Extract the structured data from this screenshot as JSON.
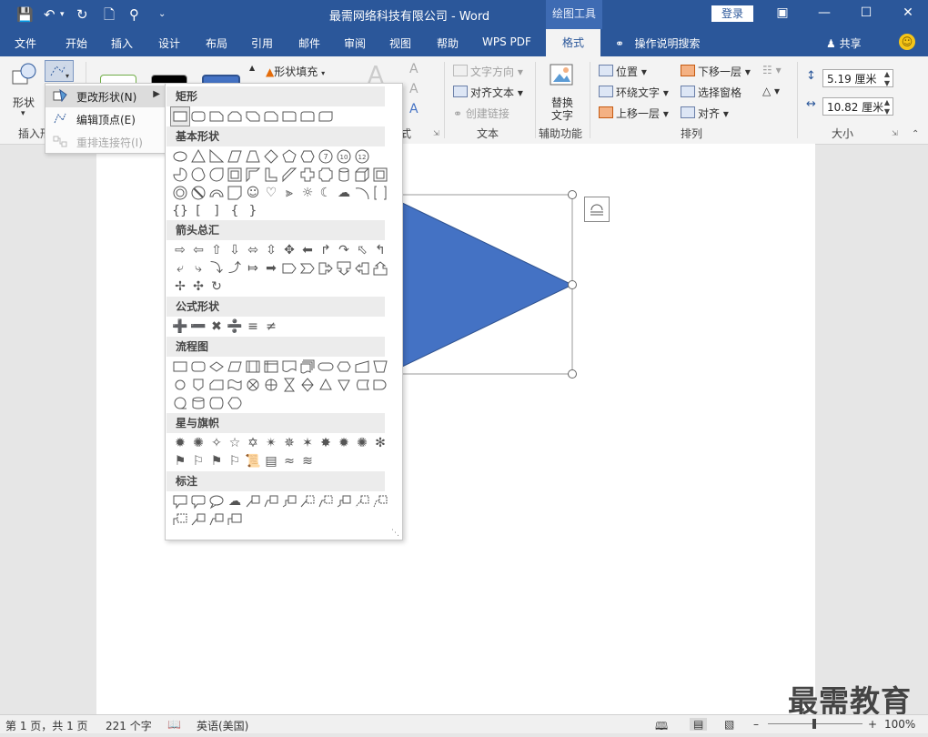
{
  "window": {
    "title": "最需网络科技有限公司  -  Word",
    "context_group": "绘图工具",
    "login_label": "登录",
    "quick_access": [
      "save-icon",
      "undo-icon",
      "redo-icon",
      "new-doc-icon",
      "touch-mode-icon",
      "customize-icon"
    ],
    "controls": [
      "ribbon-display-icon",
      "minimize-icon",
      "maximize-icon",
      "close-icon"
    ]
  },
  "tabs": [
    {
      "label": "文件"
    },
    {
      "label": "开始"
    },
    {
      "label": "插入"
    },
    {
      "label": "设计"
    },
    {
      "label": "布局"
    },
    {
      "label": "引用"
    },
    {
      "label": "邮件"
    },
    {
      "label": "审阅"
    },
    {
      "label": "视图"
    },
    {
      "label": "帮助"
    },
    {
      "label": "WPS PDF"
    },
    {
      "label": "格式",
      "active": true
    }
  ],
  "tell_me": "操作说明搜索",
  "share": "共享",
  "ribbon": {
    "insert_shapes": {
      "shapes_label": "形状",
      "group_label": "插入形"
    },
    "shape_styles": {
      "fill_label": "形状填充",
      "group_label": "式"
    },
    "wordart": {
      "letters": [
        "A",
        "A",
        "A",
        "A"
      ]
    },
    "text": {
      "direction_label": "文字方向",
      "align_label": "对齐文本",
      "link_label": "创建链接",
      "group_label": "文本"
    },
    "accessibility": {
      "alt_text_line1": "替换",
      "alt_text_line2": "文字",
      "group_label": "辅助功能"
    },
    "arrange": {
      "position_label": "位置",
      "wrap_label": "环绕文字",
      "bring_forward_label": "上移一层",
      "send_backward_label": "下移一层",
      "selection_pane_label": "选择窗格",
      "align_label": "对齐",
      "group_label": "排列"
    },
    "size": {
      "height_value": "5.19 厘米",
      "width_value": "10.82 厘米",
      "group_label": "大小"
    }
  },
  "edit_shape_menu": {
    "items": [
      {
        "label": "更改形状(N)",
        "enabled": true,
        "has_submenu": true
      },
      {
        "label": "编辑顶点(E)",
        "enabled": true
      },
      {
        "label": "重排连接符(I)",
        "enabled": false
      }
    ]
  },
  "shape_gallery": {
    "categories": [
      {
        "label": "矩形",
        "count": 9
      },
      {
        "label": "基本形状",
        "count": 42
      },
      {
        "label": "箭头总汇",
        "count": 27
      },
      {
        "label": "公式形状",
        "count": 6
      },
      {
        "label": "流程图",
        "count": 28
      },
      {
        "label": "星与旗帜",
        "count": 20
      },
      {
        "label": "标注",
        "count": 16
      }
    ],
    "basic_shape_numbers": [
      "7",
      "10",
      "12"
    ],
    "brace_glyphs": [
      "{}",
      "[",
      "]",
      "{",
      "}"
    ]
  },
  "shape": {
    "fill_color": "#4472c4",
    "kind": "triangle"
  },
  "status_bar": {
    "page": "第 1 页，共 1 页",
    "words": "221 个字",
    "language": "英语(美国)",
    "zoom": "100%"
  },
  "watermark": "最需教育",
  "colors": {
    "brand": "#2b579a",
    "ribbon_bg": "#f3f3f3",
    "shape_fill": "#4472c4"
  }
}
